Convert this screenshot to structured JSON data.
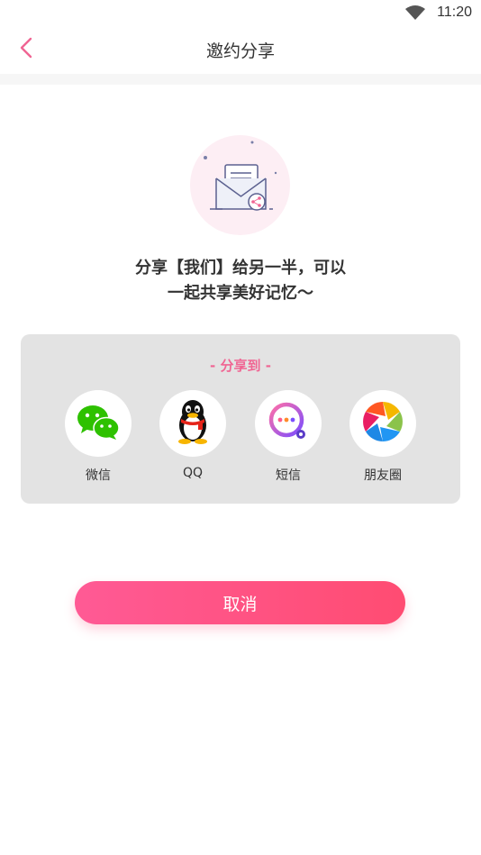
{
  "status_bar": {
    "time": "11:20"
  },
  "header": {
    "title": "邀约分享"
  },
  "promo": {
    "line1": "分享【我们】给另一半，可以",
    "line2": "一起共享美好记忆～"
  },
  "share": {
    "title": "- 分享到 -",
    "items": [
      {
        "label": "微信",
        "icon": "wechat-icon"
      },
      {
        "label": "QQ",
        "icon": "qq-icon"
      },
      {
        "label": "短信",
        "icon": "sms-icon"
      },
      {
        "label": "朋友圈",
        "icon": "moments-icon"
      }
    ]
  },
  "cancel_label": "取消",
  "colors": {
    "accent": "#f06593",
    "button": "#ff4f7a",
    "panel": "#e3e3e3"
  }
}
